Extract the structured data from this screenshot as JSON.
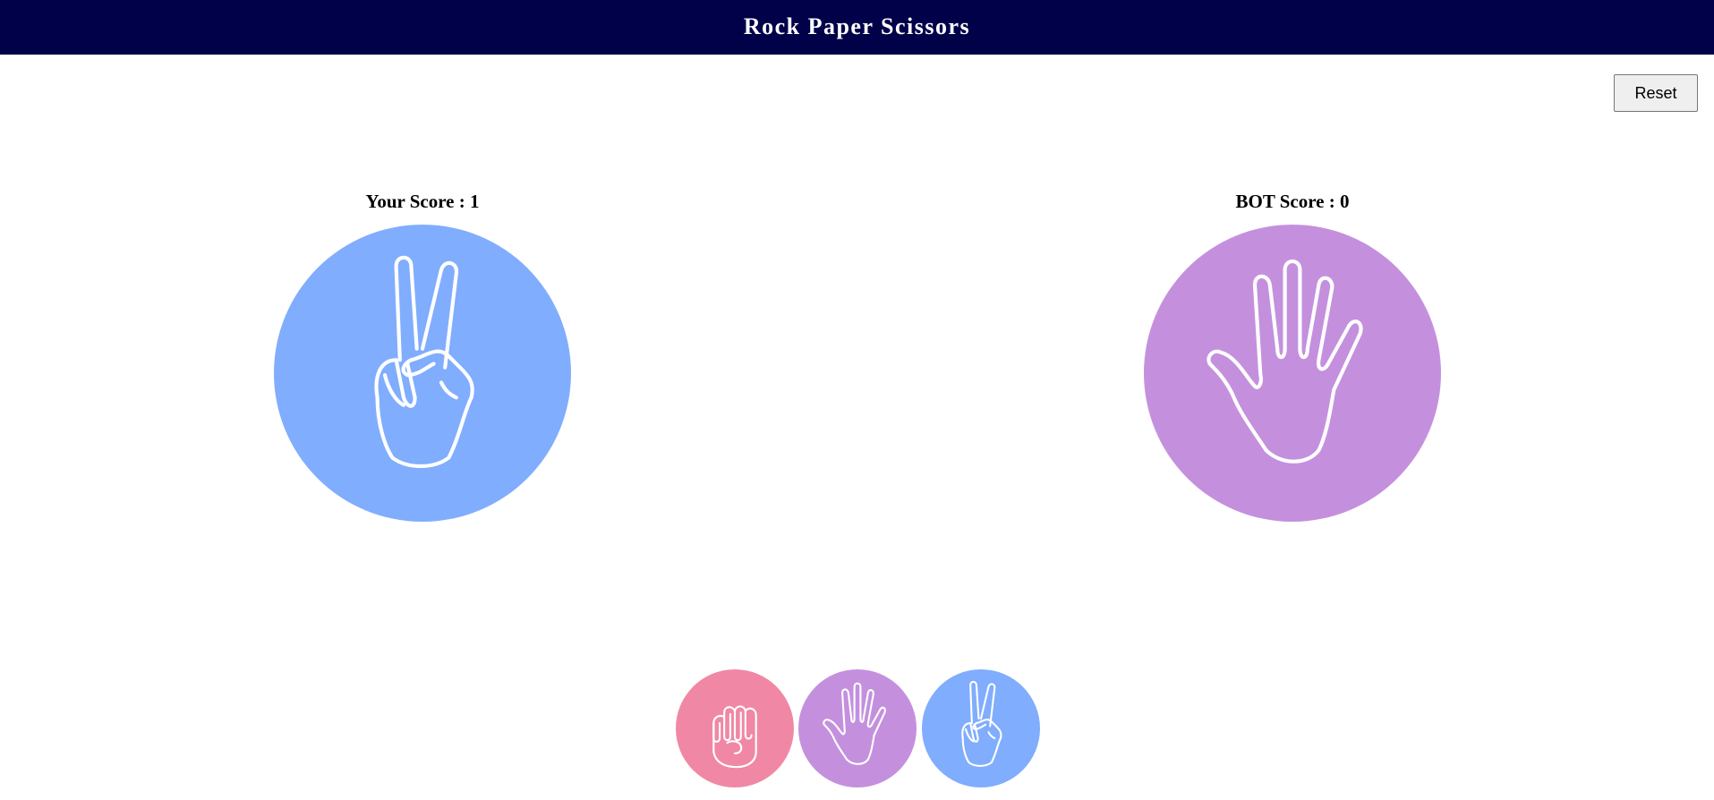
{
  "header": {
    "title": "Rock Paper Scissors"
  },
  "controls": {
    "reset_label": "Reset"
  },
  "player": {
    "score_label": "Your Score : 1",
    "choice_icon": "scissors-hand-icon",
    "color": "#80adfd"
  },
  "bot": {
    "score_label": "BOT Score : 0",
    "choice_icon": "paper-hand-icon",
    "color": "#c490de"
  },
  "choices": [
    {
      "name": "rock",
      "icon": "rock-fist-icon",
      "color": "#f088a5"
    },
    {
      "name": "paper",
      "icon": "paper-hand-icon",
      "color": "#c490de"
    },
    {
      "name": "scissors",
      "icon": "scissors-hand-icon",
      "color": "#80adfd"
    }
  ],
  "colors": {
    "header_bg": "#01014a",
    "header_text": "#ffffff"
  }
}
